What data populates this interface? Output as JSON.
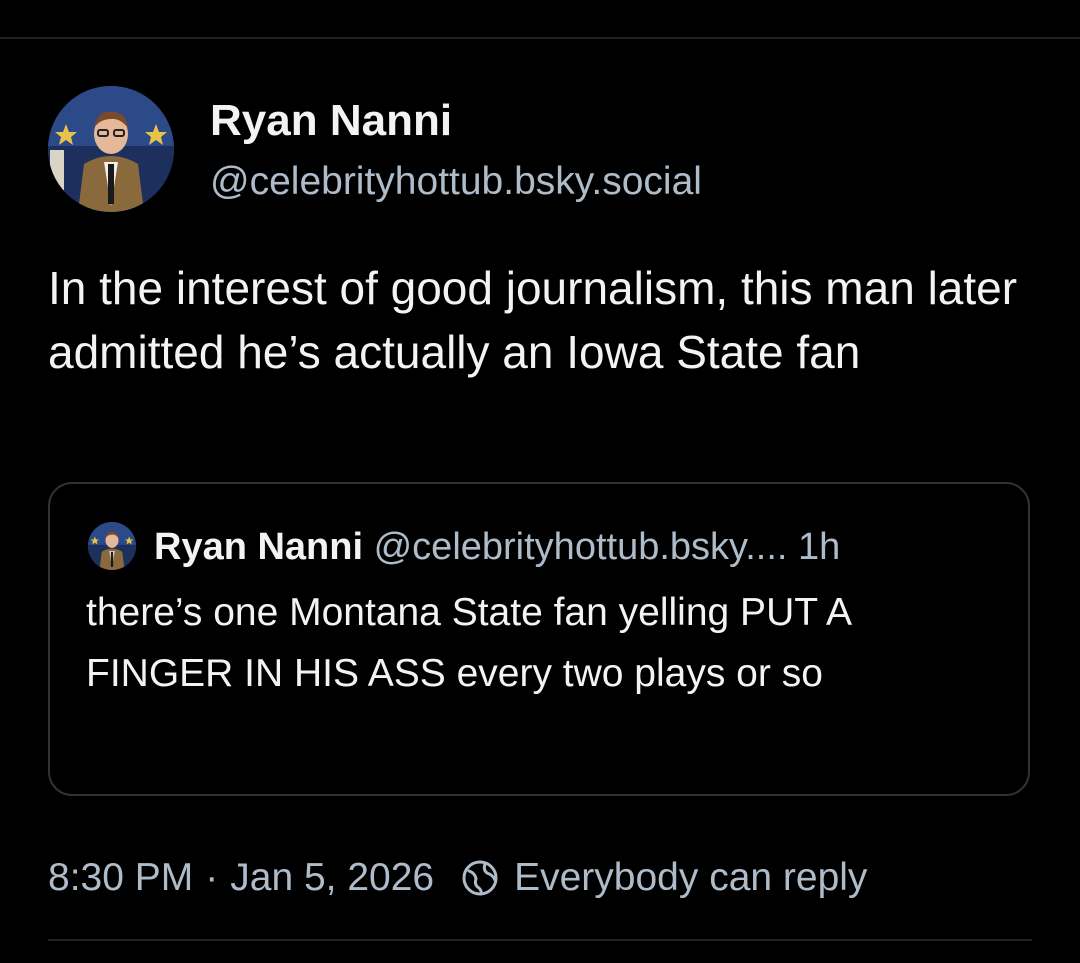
{
  "post": {
    "author": {
      "display_name": "Ryan Nanni",
      "handle": "@celebrityhottub.bsky.social",
      "avatar_icon": "user-avatar"
    },
    "text": "In the interest of good journalism, this man later admitted he’s actually an Iowa State fan",
    "quote": {
      "author_name": "Ryan Nanni",
      "author_handle": "@celebrityhottub.bsky....",
      "time_ago": "1h",
      "text": "there’s one Montana State fan yelling PUT A FINGER IN HIS ASS every two plays or so"
    },
    "time": "8:30 PM",
    "separator": "·",
    "date": "Jan 5, 2026",
    "reply_setting": {
      "icon": "globe-icon",
      "label": "Everybody can reply"
    }
  },
  "colors": {
    "background": "#000000",
    "primary_text": "#f1f3f5",
    "secondary_text": "#aebbc9",
    "border": "#2e3338"
  }
}
